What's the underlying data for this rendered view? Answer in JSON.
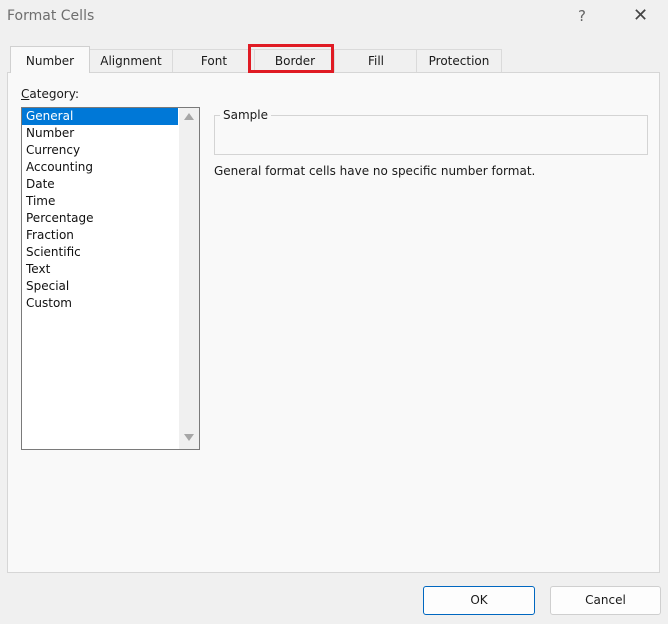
{
  "window": {
    "title": "Format Cells",
    "help_glyph": "?",
    "close_glyph": "✕"
  },
  "tabs": [
    {
      "label": "Number",
      "active": true
    },
    {
      "label": "Alignment"
    },
    {
      "label": "Font"
    },
    {
      "label": "Border",
      "highlighted": true
    },
    {
      "label": "Fill"
    },
    {
      "label": "Protection"
    }
  ],
  "category": {
    "label_first": "C",
    "label_rest": "ategory:",
    "items": [
      "General",
      "Number",
      "Currency",
      "Accounting",
      "Date",
      "Time",
      "Percentage",
      "Fraction",
      "Scientific",
      "Text",
      "Special",
      "Custom"
    ],
    "selected": "General"
  },
  "sample": {
    "label": "Sample",
    "value": ""
  },
  "description": "General format cells have no specific number format.",
  "buttons": {
    "ok": "OK",
    "cancel": "Cancel"
  },
  "colors": {
    "highlight": "#e01b24",
    "selection": "#0078d7",
    "ok_border": "#0067c0"
  }
}
